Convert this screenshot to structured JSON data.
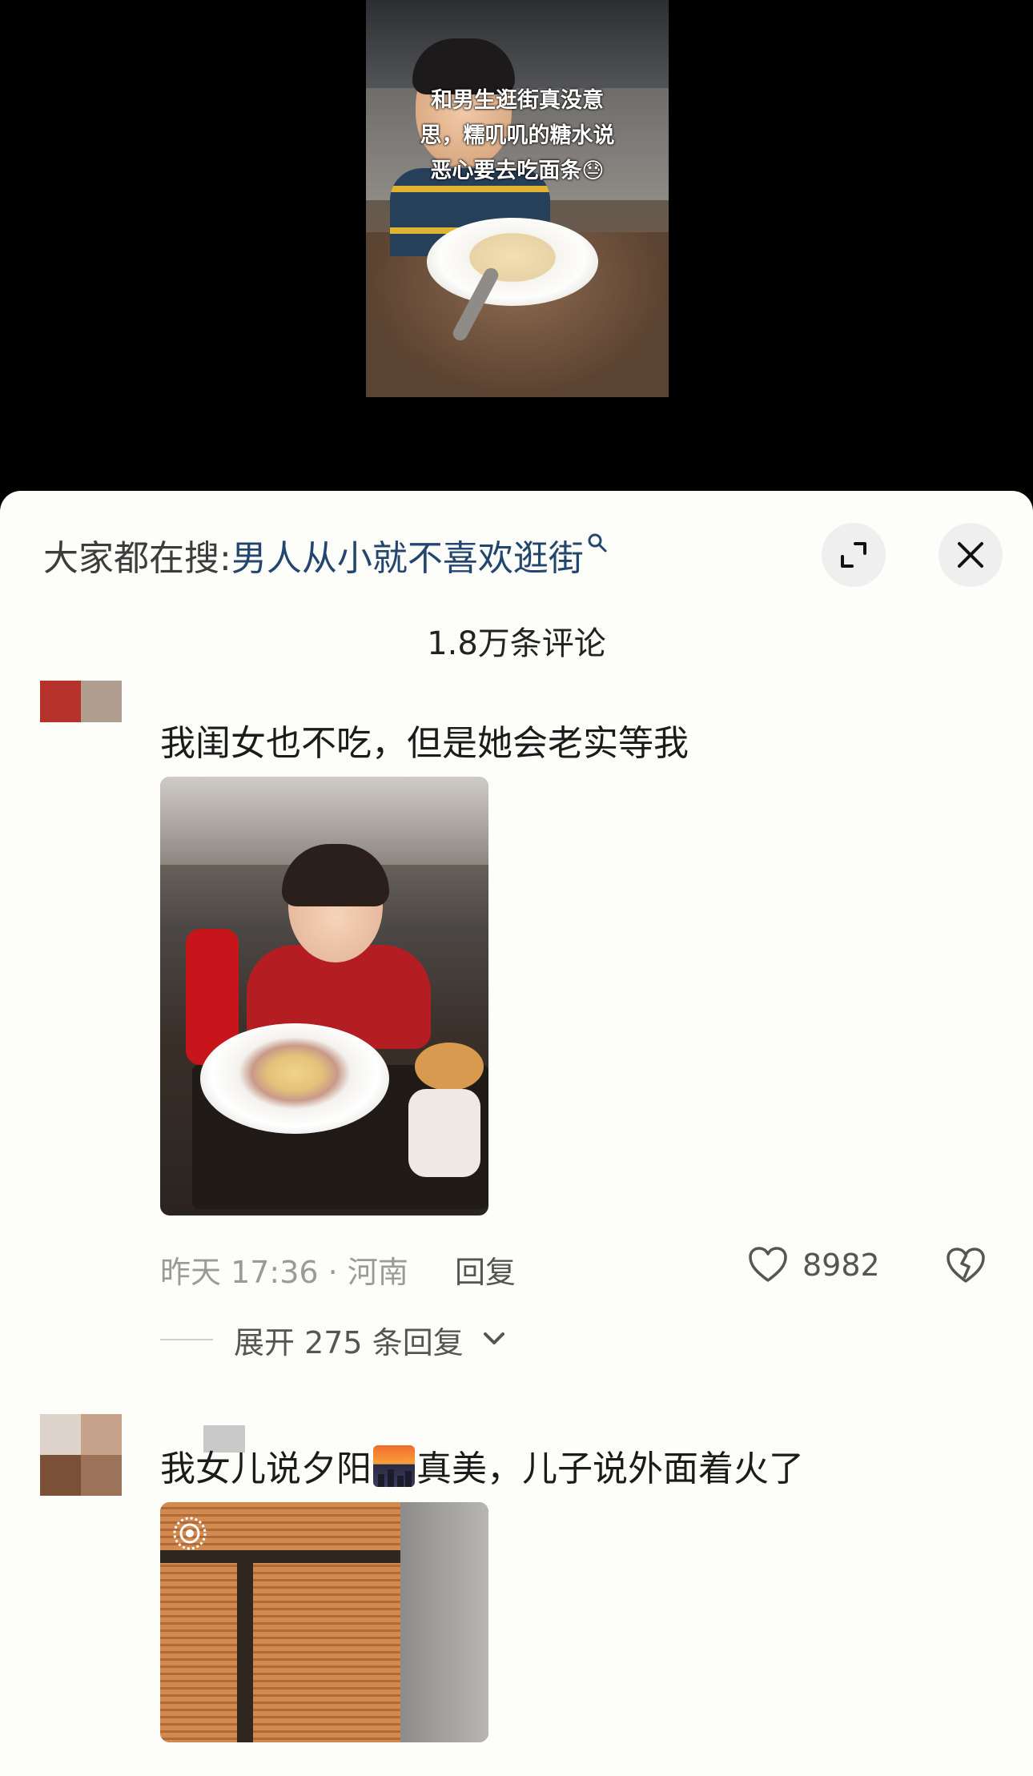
{
  "video": {
    "caption_lines": [
      "和男生逛街真没意",
      "思，糯叽叽的糖水说",
      "恶心要去吃面条😓"
    ]
  },
  "sheet": {
    "search_label": "大家都在搜:",
    "search_term": "男人从小就不喜欢逛街",
    "comment_count": "1.8万条评论",
    "icons": [
      "search-icon",
      "expand-icon",
      "close-icon"
    ]
  },
  "comments": [
    {
      "text": "我闺女也不吃，但是她会老实等我",
      "time_location": "昨天 17:36 · 河南",
      "reply_label": "回复",
      "likes": "8982",
      "expand_replies": "展开 275 条回复"
    },
    {
      "text_before": "我女儿说夕阳",
      "text_after": "真美，儿子说外面着火了"
    }
  ],
  "colors": {
    "search_term": "#23466f",
    "sheet_bg": "#fdfdfa",
    "like_accent": "#555555"
  }
}
